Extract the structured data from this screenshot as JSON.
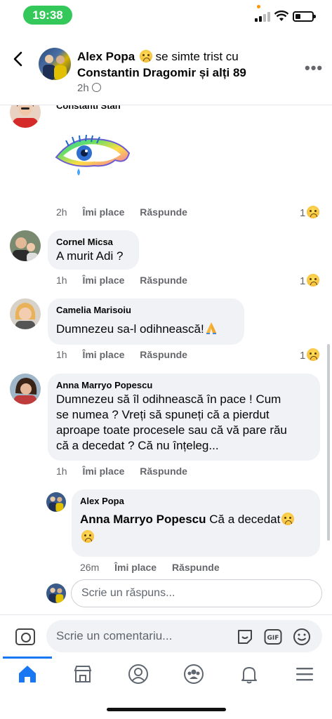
{
  "status": {
    "time": "19:38"
  },
  "header": {
    "author": "Alex Popa",
    "feeling": "se simte trist cu",
    "with": "Constantin Dragomir și alți 89",
    "time": "2h"
  },
  "comments": [
    {
      "name": "Constanti Stan",
      "text": "",
      "time": "2h",
      "like": "Îmi place",
      "reply": "Răspunde",
      "reactions": "1"
    },
    {
      "name": "Cornel Micsa",
      "text": "A murit Adi ?",
      "time": "1h",
      "like": "Îmi place",
      "reply": "Răspunde",
      "reactions": "1"
    },
    {
      "name": "Camelia Marisoiu",
      "text": "Dumnezeu sa-l odihnească!",
      "time": "1h",
      "like": "Îmi place",
      "reply": "Răspunde",
      "reactions": "1"
    },
    {
      "name": "Anna Marryo Popescu",
      "text_lines": [
        "Dumnezeu să îl odihnească în pace  ! Cum",
        "se numea  ? Vreți să spuneți că a pierdut",
        "aproape toate procesele sau că vă  pare rău",
        "că  a decedat ? Că nu înțeleg..."
      ],
      "time": "1h",
      "like": "Îmi place",
      "reply": "Răspunde"
    }
  ],
  "reply_comment": {
    "name": "Alex Popa",
    "mention": "Anna Marryo Popescu",
    "text": "Că a decedat",
    "time": "26m",
    "like": "Îmi place",
    "reply": "Răspunde"
  },
  "reply_box": {
    "placeholder": "Scrie un răspuns..."
  },
  "comment_bar": {
    "placeholder": "Scrie un comentariu..."
  },
  "icons": [
    "back-icon",
    "globe-icon",
    "more-icon",
    "camera-icon",
    "sticker-icon",
    "gif-icon",
    "emoji-icon",
    "home-icon",
    "marketplace-icon",
    "profile-icon",
    "groups-icon",
    "bell-icon",
    "menu-icon"
  ]
}
